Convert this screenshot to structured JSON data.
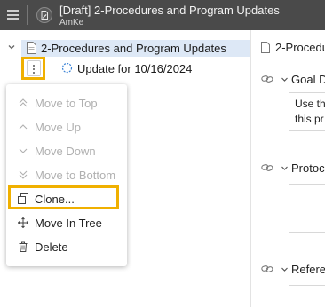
{
  "titlebar": {
    "title": "[Draft] 2-Procedures and Program Updates",
    "subtitle": "AmKe",
    "menu_icon": "hamburger-icon",
    "doc_icon": "edit-document-icon",
    "background": "#4a4a4a"
  },
  "tree": {
    "root": {
      "label": "2-Procedures and Program Updates",
      "icon": "document-icon",
      "expanded": true,
      "selected_bg": "#dde8f6"
    },
    "child": {
      "label": "Update for 10/16/2024",
      "icon": "update-icon"
    }
  },
  "context_menu": {
    "items": [
      {
        "label": "Move to Top",
        "icon": "double-chevron-up-icon",
        "enabled": false
      },
      {
        "label": "Move Up",
        "icon": "chevron-up-icon",
        "enabled": false
      },
      {
        "label": "Move Down",
        "icon": "chevron-down-icon",
        "enabled": false
      },
      {
        "label": "Move to Bottom",
        "icon": "double-chevron-down-icon",
        "enabled": false
      },
      {
        "label": "Clone...",
        "icon": "clone-icon",
        "enabled": true
      },
      {
        "label": "Move In Tree",
        "icon": "move-icon",
        "enabled": true
      },
      {
        "label": "Delete",
        "icon": "trash-icon",
        "enabled": true
      }
    ]
  },
  "highlight_color": "#f0b000",
  "right_panel": {
    "header": "2-Procedu",
    "sections": [
      {
        "title": "Goal D",
        "content_lines": [
          "Use th",
          "this pr"
        ]
      },
      {
        "title": "Protoc",
        "content_lines": []
      },
      {
        "title": "Refere",
        "content_lines": []
      }
    ]
  }
}
